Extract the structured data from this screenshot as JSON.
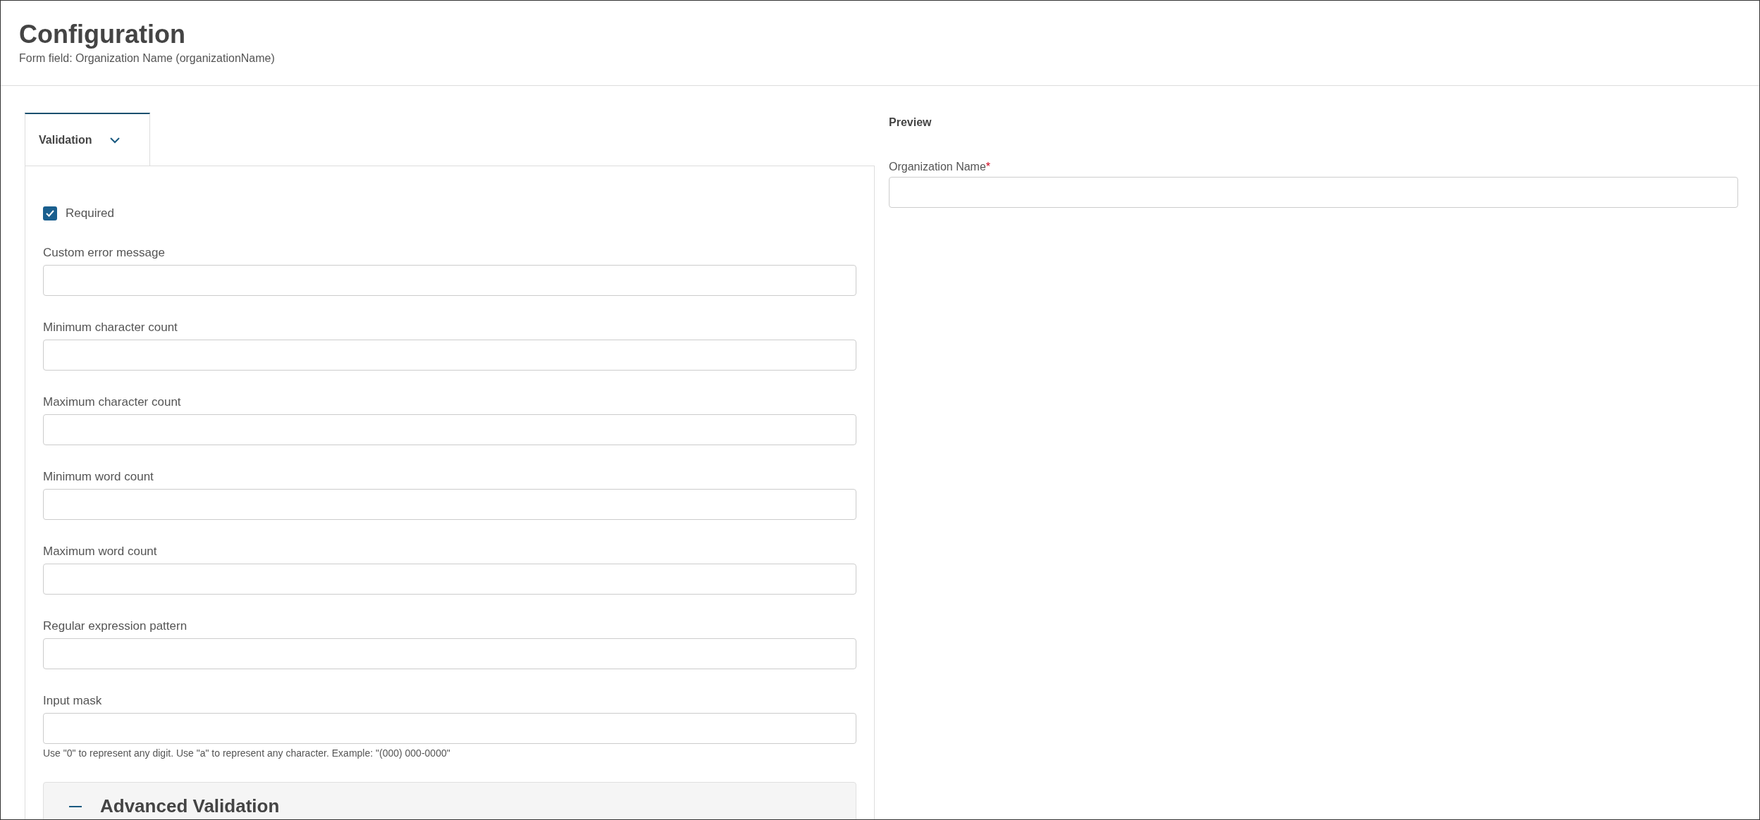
{
  "header": {
    "title": "Configuration",
    "subtitle": "Form field: Organization Name (organizationName)"
  },
  "tabs": [
    {
      "label": "Validation",
      "selected": true
    }
  ],
  "required": {
    "label": "Required",
    "checked": true
  },
  "fields": [
    {
      "label": "Custom error message"
    },
    {
      "label": "Minimum character count"
    },
    {
      "label": "Maximum character count"
    },
    {
      "label": "Minimum word count"
    },
    {
      "label": "Maximum word count"
    },
    {
      "label": "Regular expression pattern"
    },
    {
      "label": "Input mask",
      "help": "Use \"0\" to represent any digit. Use \"a\" to represent any character. Example: \"(000) 000-0000\""
    }
  ],
  "advanced": {
    "title": "Advanced Validation",
    "expanded": true
  },
  "preview": {
    "title": "Preview",
    "field": {
      "label": "Organization Name",
      "required_mark": "*"
    }
  }
}
